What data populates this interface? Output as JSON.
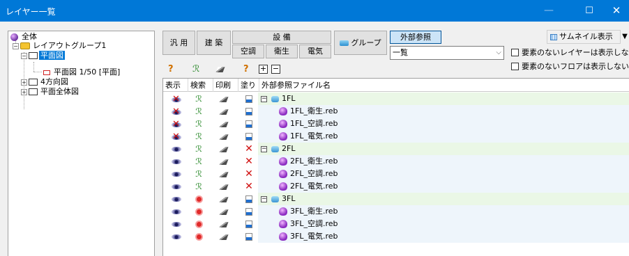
{
  "window": {
    "title": "レイヤー一覧",
    "minimize": "—",
    "maximize": "☐",
    "close": "✕"
  },
  "tree": {
    "root": "全体",
    "group1": "レイアウトグループ1",
    "plan": "平面図",
    "plan_sheet": "平面図 1/50 [平面]",
    "four": "4方向図",
    "overall": "平面全体図"
  },
  "toolbar": {
    "general": "汎 用",
    "architecture": "建 築",
    "equipment": "設 備",
    "hvac": "空調",
    "sanitary": "衛生",
    "electric": "電気",
    "group": "グループ",
    "external_ref": "外部参照",
    "view_select": "一覧",
    "thumbnail": "サムネイル表示",
    "hide_empty_layers": "要素のないレイヤーは表示しない",
    "hide_empty_floors": "要素のないフロアは表示しない"
  },
  "columns": [
    "表示",
    "検索",
    "印刷",
    "塗り",
    "外部参照ファイル名"
  ],
  "rows": [
    {
      "type": "group",
      "name": "1FL",
      "display": "off",
      "search": "on",
      "print": "on",
      "fill": "on"
    },
    {
      "type": "file",
      "name": "1FL_衛生.reb",
      "display": "off",
      "search": "on",
      "print": "on",
      "fill": "on"
    },
    {
      "type": "file",
      "name": "1FL_空調.reb",
      "display": "off",
      "search": "on",
      "print": "on",
      "fill": "on"
    },
    {
      "type": "file",
      "name": "1FL_電気.reb",
      "display": "off",
      "search": "on",
      "print": "on",
      "fill": "on"
    },
    {
      "type": "group",
      "name": "2FL",
      "display": "on",
      "search": "on",
      "print": "on",
      "fill": "off"
    },
    {
      "type": "file",
      "name": "2FL_衛生.reb",
      "display": "on",
      "search": "on",
      "print": "on",
      "fill": "off"
    },
    {
      "type": "file",
      "name": "2FL_空調.reb",
      "display": "on",
      "search": "on",
      "print": "on",
      "fill": "off"
    },
    {
      "type": "file",
      "name": "2FL_電気.reb",
      "display": "on",
      "search": "on",
      "print": "on",
      "fill": "off"
    },
    {
      "type": "group",
      "name": "3FL",
      "display": "on",
      "search": "off",
      "print": "on",
      "fill": "on"
    },
    {
      "type": "file",
      "name": "3FL_衛生.reb",
      "display": "on",
      "search": "off",
      "print": "on",
      "fill": "on"
    },
    {
      "type": "file",
      "name": "3FL_空調.reb",
      "display": "on",
      "search": "off",
      "print": "on",
      "fill": "on"
    },
    {
      "type": "file",
      "name": "3FL_電気.reb",
      "display": "on",
      "search": "off",
      "print": "on",
      "fill": "on"
    }
  ]
}
